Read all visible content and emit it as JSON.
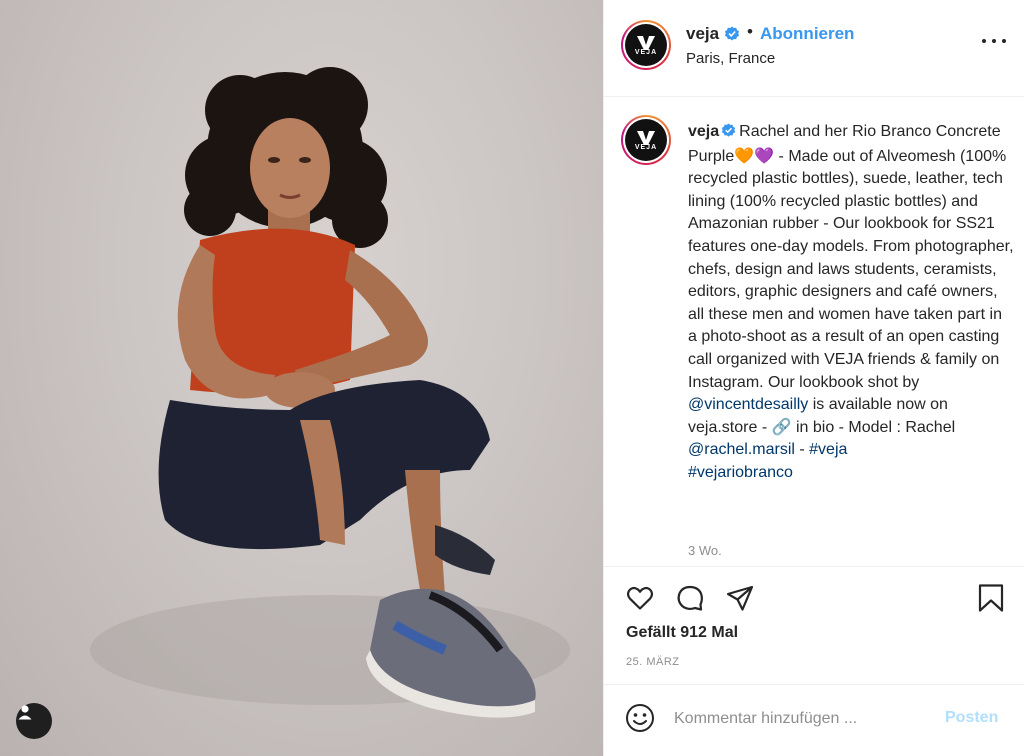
{
  "photo": {
    "alt_icon": "user-tag-icon",
    "colors": {
      "backdrop": "#cbc5c3",
      "top": "#c0401e",
      "jeans": "#1f2233",
      "skin": "#b07a5a",
      "hair": "#1c1410"
    }
  },
  "header": {
    "username": "veja",
    "verified_icon": "verified-badge-icon",
    "separator": "•",
    "follow_label": "Abonnieren",
    "location": "Paris, France",
    "avatar_logo_text": "VEJA",
    "more_icon": "more-options-icon"
  },
  "caption": {
    "username": "veja",
    "text_1": "Rachel and her Rio Branco Concrete Purple",
    "emoji": "🧡💜",
    "text_2": " - Made out of Alveomesh (100% recycled plastic bottles), suede, leather, tech lining (100% recycled plastic bottles) and Amazonian rubber - Our lookbook for SS21 features one-day models. From photographer, chefs, design and laws students, ceramists, editors, graphic designers and café owners, all these men and women have taken part in a photo-shoot as a result of an open casting call organized with VEJA friends & family on Instagram. Our lookbook shot by ",
    "mention_1": "@vincentdesailly",
    "text_3": " is available now on veja.store - ",
    "link_emoji": "🔗",
    "text_4": " in bio - Model : Rachel ",
    "mention_2": "@rachel.marsil",
    "text_5": " - ",
    "hashtag_1": "#veja",
    "hashtag_2": "#vejariobranco",
    "time": "3 Wo."
  },
  "actions": {
    "like_icon": "heart-icon",
    "comment_icon": "comment-icon",
    "share_icon": "share-icon",
    "save_icon": "bookmark-icon",
    "likes_text": "Gefällt 912 Mal",
    "date": "25. MÄRZ"
  },
  "comment_box": {
    "emoji_icon": "emoji-icon",
    "placeholder": "Kommentar hinzufügen ...",
    "post_label": "Posten",
    "post_color": "#b2dffc"
  }
}
